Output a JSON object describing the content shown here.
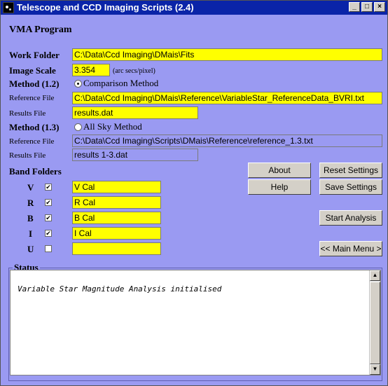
{
  "window": {
    "title": "Telescope and CCD Imaging Scripts (2.4)",
    "min": "_",
    "max": "□",
    "close": "×"
  },
  "program_title": "VMA Program",
  "work_folder": {
    "label": "Work Folder",
    "value": "C:\\Data\\Ccd Imaging\\DMais\\Fits"
  },
  "image_scale": {
    "label": "Image Scale",
    "value": "3.354",
    "unit": "(arc secs/pixel)"
  },
  "method_12": {
    "label": "Method (1.2)",
    "option": "Comparison Method",
    "selected": true,
    "reference_label": "Reference File",
    "reference_value": "C:\\Data\\Ccd Imaging\\DMais\\Reference\\VariableStar_ReferenceData_BVRI.txt",
    "results_label": "Results File",
    "results_value": "results.dat"
  },
  "method_13": {
    "label": "Method (1.3)",
    "option": "All Sky Method",
    "selected": false,
    "reference_label": "Reference File",
    "reference_value": "C:\\Data\\Ccd Imaging\\Scripts\\DMais\\Reference\\reference_1.3.txt",
    "results_label": "Results File",
    "results_value": "results 1-3.dat"
  },
  "band_folders": {
    "label": "Band Folders",
    "bands": [
      {
        "band": "V",
        "checked": true,
        "check_mark": "✔",
        "folder": "V Cal"
      },
      {
        "band": "R",
        "checked": true,
        "check_mark": "✔",
        "folder": "R Cal"
      },
      {
        "band": "B",
        "checked": true,
        "check_mark": "✔",
        "folder": "B Cal"
      },
      {
        "band": "I",
        "checked": true,
        "check_mark": "✔",
        "folder": "I Cal"
      },
      {
        "band": "U",
        "checked": false,
        "check_mark": "",
        "folder": ""
      }
    ]
  },
  "buttons": {
    "about": "About",
    "reset": "Reset Settings",
    "help": "Help",
    "save": "Save Settings",
    "start": "Start Analysis",
    "main_menu": "<< Main Menu >"
  },
  "status": {
    "label": "Status",
    "message": "Variable Star Magnitude Analysis initialised",
    "scroll_up": "▲",
    "scroll_down": "▼"
  },
  "colors": {
    "background": "#9a9af2",
    "field": "#ffff00",
    "titlebar": "#0a24a8"
  }
}
